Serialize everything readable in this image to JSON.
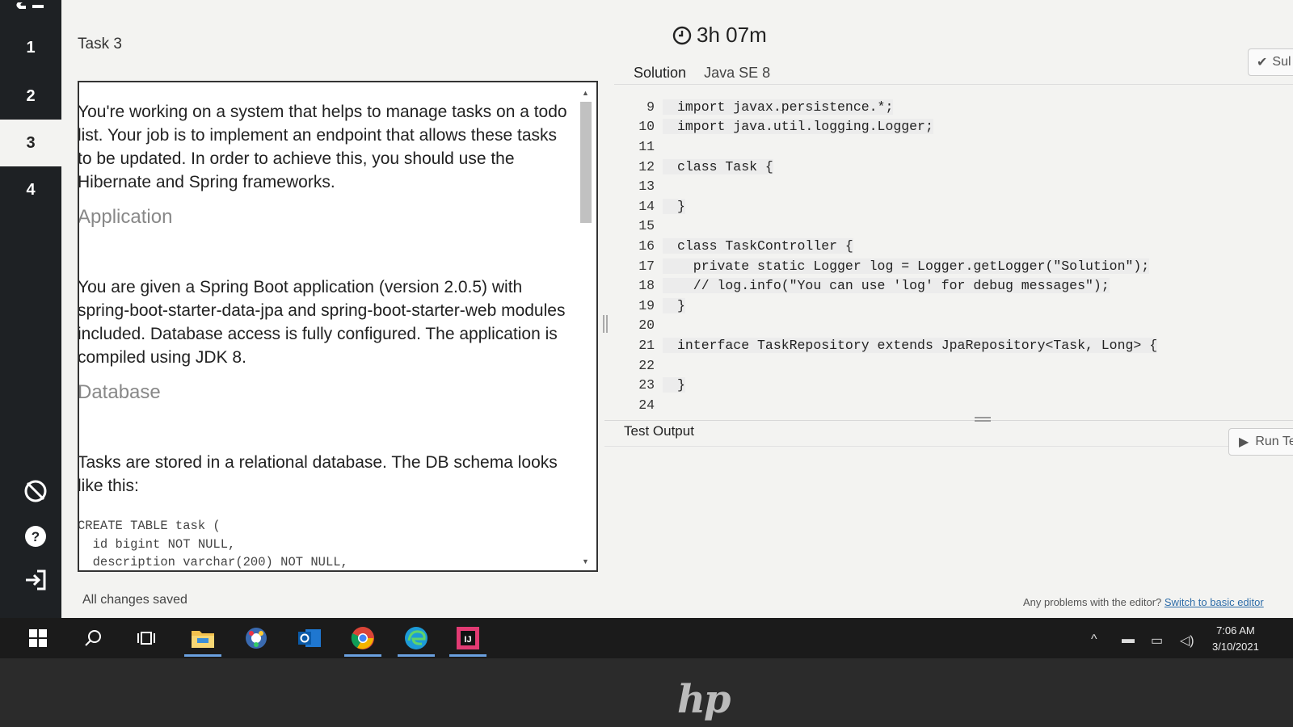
{
  "nav": {
    "items": [
      {
        "label": "1"
      },
      {
        "label": "2"
      },
      {
        "label": "3"
      },
      {
        "label": "4"
      }
    ],
    "active_index": 2,
    "bottom_icons": [
      "hide-icon",
      "help-icon",
      "logout-icon"
    ]
  },
  "header": {
    "task_title": "Task 3",
    "timer": "3h 07m",
    "submit_label": "Sul"
  },
  "description": {
    "intro": "You're working on a system that helps to manage tasks on a todo list. Your job is to implement an endpoint that allows these tasks to be updated. In order to achieve this, you should use the Hibernate and Spring frameworks.",
    "heading_application": "Application",
    "application_text": "You are given a Spring Boot application (version 2.0.5) with spring-boot-starter-data-jpa and spring-boot-starter-web modules included. Database access is fully configured. The application is compiled using JDK 8.",
    "heading_database": "Database",
    "database_text": "Tasks are stored in a relational database. The DB schema looks like this:",
    "schema": "CREATE TABLE task (\n  id bigint NOT NULL,\n  description varchar(200) NOT NULL,"
  },
  "editor": {
    "tab_solution": "Solution",
    "tab_language": "Java SE 8",
    "lines": [
      {
        "n": "9",
        "code": "import javax.persistence.*;"
      },
      {
        "n": "10",
        "code": "import java.util.logging.Logger;"
      },
      {
        "n": "11",
        "code": ""
      },
      {
        "n": "12",
        "code": "class Task {"
      },
      {
        "n": "13",
        "code": ""
      },
      {
        "n": "14",
        "code": "}"
      },
      {
        "n": "15",
        "code": ""
      },
      {
        "n": "16",
        "code": "class TaskController {"
      },
      {
        "n": "17",
        "code": "  private static Logger log = Logger.getLogger(\"Solution\");"
      },
      {
        "n": "18",
        "code": "  // log.info(\"You can use 'log' for debug messages\");"
      },
      {
        "n": "19",
        "code": "}"
      },
      {
        "n": "20",
        "code": ""
      },
      {
        "n": "21",
        "code": "interface TaskRepository extends JpaRepository<Task, Long> {"
      },
      {
        "n": "22",
        "code": ""
      },
      {
        "n": "23",
        "code": "}"
      },
      {
        "n": "24",
        "code": ""
      }
    ]
  },
  "test_output": {
    "title": "Test Output",
    "run_label": "Run Te"
  },
  "status": {
    "saved": "All changes saved",
    "problems_text": "Any problems with the editor?",
    "switch_link": "Switch to basic editor"
  },
  "taskbar": {
    "time": "7:06 AM",
    "date": "3/10/2021",
    "apps": [
      "windows-start-icon",
      "search-icon",
      "task-view-icon",
      "file-explorer-icon",
      "settings-app-icon",
      "outlook-icon",
      "chrome-icon",
      "edge-icon",
      "intellij-icon"
    ]
  },
  "bezel": {
    "brand": "hp"
  },
  "colors": {
    "nav_bg": "#1e2124",
    "keyword": "#1a3fa0",
    "taskbar_bg": "#1b1b1b"
  }
}
